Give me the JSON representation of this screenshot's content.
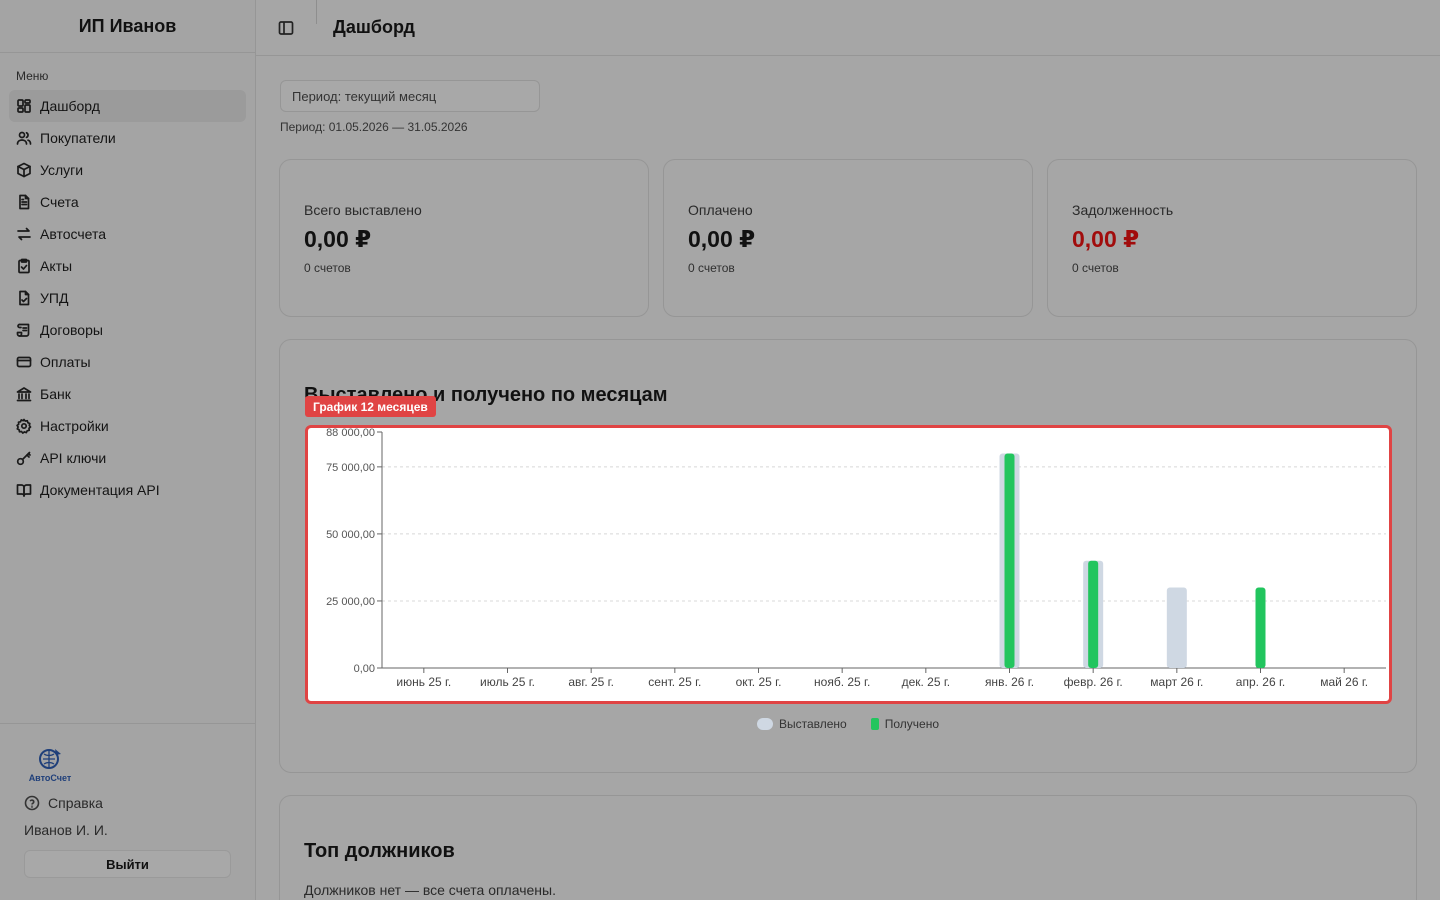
{
  "sidebar": {
    "brand": "ИП Иванов",
    "menu_title": "Меню",
    "items": [
      {
        "label": "Дашборд",
        "icon": "dashboard-icon"
      },
      {
        "label": "Покупатели",
        "icon": "users-icon"
      },
      {
        "label": "Услуги",
        "icon": "box-icon"
      },
      {
        "label": "Счета",
        "icon": "document-icon"
      },
      {
        "label": "Автосчета",
        "icon": "repeat-icon"
      },
      {
        "label": "Акты",
        "icon": "clipboard-check-icon"
      },
      {
        "label": "УПД",
        "icon": "file-check-icon"
      },
      {
        "label": "Договоры",
        "icon": "scroll-icon"
      },
      {
        "label": "Оплаты",
        "icon": "credit-card-icon"
      },
      {
        "label": "Банк",
        "icon": "bank-icon"
      },
      {
        "label": "Настройки",
        "icon": "gear-icon"
      },
      {
        "label": "API ключи",
        "icon": "key-icon"
      },
      {
        "label": "Документация API",
        "icon": "book-icon"
      }
    ],
    "logo_text": "АвтоСчет",
    "help_label": "Справка",
    "user_name": "Иванов И. И.",
    "logout_label": "Выйти"
  },
  "header": {
    "title": "Дашборд"
  },
  "filters": {
    "period_value": "Период: текущий месяц",
    "period_caption": "Период: 01.05.2026 — 31.05.2026"
  },
  "cards": {
    "total": {
      "label": "Всего выставлено",
      "value": "0,00 ₽",
      "sub": "0 счетов"
    },
    "paid": {
      "label": "Оплачено",
      "value": "0,00 ₽",
      "sub": "0 счетов"
    },
    "debt": {
      "label": "Задолженность",
      "value": "0,00 ₽",
      "sub": "0 счетов"
    }
  },
  "colors": {
    "issued": "#cfd8e3",
    "received": "#22c55e",
    "debt_value": "#a10c0c",
    "badge": "#e04444"
  },
  "chart_section": {
    "title": "Выставлено и получено по месяцам",
    "badge": "График 12 месяцев"
  },
  "chart_data": {
    "type": "bar",
    "categories": [
      "июнь 25 г.",
      "июль 25 г.",
      "авг. 25 г.",
      "сент. 25 г.",
      "окт. 25 г.",
      "нояб. 25 г.",
      "дек. 25 г.",
      "янв. 26 г.",
      "февр. 26 г.",
      "март 26 г.",
      "апр. 26 г.",
      "май 26 г."
    ],
    "series": [
      {
        "name": "Выставлено",
        "values": [
          0,
          0,
          0,
          0,
          0,
          0,
          0,
          80000,
          40000,
          30000,
          0,
          0
        ]
      },
      {
        "name": "Получено",
        "values": [
          0,
          0,
          0,
          0,
          0,
          0,
          0,
          80000,
          40000,
          0,
          30000,
          0
        ]
      }
    ],
    "yticks": [
      {
        "value": 0,
        "label": "0,00"
      },
      {
        "value": 25000,
        "label": "25 000,00"
      },
      {
        "value": 50000,
        "label": "50 000,00"
      },
      {
        "value": 75000,
        "label": "75 000,00"
      },
      {
        "value": 88000,
        "label": "88 000,00"
      }
    ],
    "ylim": [
      0,
      88000
    ],
    "grid": true,
    "legend_position": "bottom"
  },
  "debtors": {
    "title": "Топ должников",
    "empty_text": "Должников нет — все счета оплачены."
  }
}
